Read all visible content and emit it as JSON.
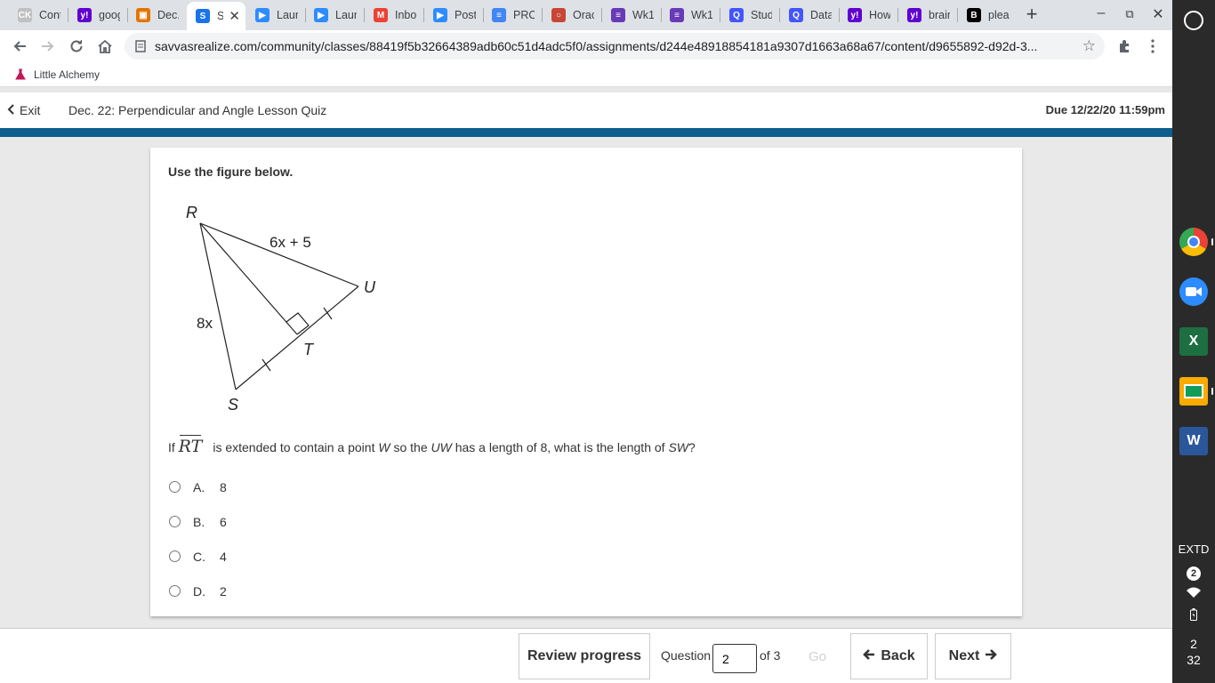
{
  "browser": {
    "tabs": [
      {
        "title": "Cont",
        "icon": "ck12-icon",
        "color": "#c0c0c0",
        "glyph": "CK"
      },
      {
        "title": "goog",
        "icon": "yahoo-icon",
        "color": "#5f01d1",
        "glyph": "y!"
      },
      {
        "title": "Dec.",
        "icon": "classroom-icon",
        "color": "#e37400",
        "glyph": "▣"
      },
      {
        "title": "S",
        "icon": "savvas-icon",
        "color": "#1a73e8",
        "glyph": "S",
        "active": true
      },
      {
        "title": "Laun",
        "icon": "zoom-icon",
        "color": "#2d8cff",
        "glyph": "▶"
      },
      {
        "title": "Laun",
        "icon": "zoom-icon",
        "color": "#2d8cff",
        "glyph": "▶"
      },
      {
        "title": "Inbo",
        "icon": "gmail-icon",
        "color": "#ea4335",
        "glyph": "M"
      },
      {
        "title": "Post",
        "icon": "zoom-icon",
        "color": "#2d8cff",
        "glyph": "▶"
      },
      {
        "title": "PRO",
        "icon": "docs-icon",
        "color": "#4285f4",
        "glyph": "≡"
      },
      {
        "title": "Orac",
        "icon": "oracle-icon",
        "color": "#c74634",
        "glyph": "○"
      },
      {
        "title": "Wk1",
        "icon": "forms-icon",
        "color": "#673ab7",
        "glyph": "≡"
      },
      {
        "title": "Wk1",
        "icon": "forms-icon",
        "color": "#673ab7",
        "glyph": "≡"
      },
      {
        "title": "Stud",
        "icon": "quizlet-icon",
        "color": "#4255ff",
        "glyph": "Q"
      },
      {
        "title": "Data",
        "icon": "quizlet-icon",
        "color": "#4255ff",
        "glyph": "Q"
      },
      {
        "title": "How",
        "icon": "yahoo-icon",
        "color": "#5f01d1",
        "glyph": "y!"
      },
      {
        "title": "brain",
        "icon": "yahoo-icon",
        "color": "#5f01d1",
        "glyph": "y!"
      },
      {
        "title": "plea",
        "icon": "brainly-icon",
        "color": "#000000",
        "glyph": "B"
      }
    ],
    "url": "savvasrealize.com/community/classes/88419f5b32664389adb60c51d4adc5f0/assignments/d244e48918854181a9307d1663a68a67/content/d9655892-d92d-3...",
    "bookmark": "Little Alchemy"
  },
  "app": {
    "exit_label": "Exit",
    "title": "Dec. 22: Perpendicular and Angle Lesson Quiz",
    "due": "Due 12/22/20 11:59pm",
    "accent": "#0c5e8f"
  },
  "quiz": {
    "instruction": "Use the figure below.",
    "figure": {
      "points": {
        "R": "R",
        "U": "U",
        "T": "T",
        "S": "S"
      },
      "label_ru": "6x + 5",
      "label_rs": "8x"
    },
    "question": {
      "prefix": "If",
      "segment": "RT",
      "part1": "is extended to contain a point",
      "w": "W",
      "part2": "so the",
      "uw": "UW",
      "part3": "has a length of 8, what is the length of",
      "sw": "SW",
      "end": "?"
    },
    "choices": [
      {
        "letter": "A.",
        "value": "8"
      },
      {
        "letter": "B.",
        "value": "6"
      },
      {
        "letter": "C.",
        "value": "4"
      },
      {
        "letter": "D.",
        "value": "2"
      }
    ]
  },
  "footer": {
    "review": "Review progress",
    "question_label": "Question",
    "current": "2",
    "of_total": "of 3",
    "go": "Go",
    "back": "Back",
    "next": "Next"
  },
  "shelf": {
    "extd": "EXTD",
    "notif_count": "2",
    "time_hour": "2",
    "time_min": "32"
  }
}
